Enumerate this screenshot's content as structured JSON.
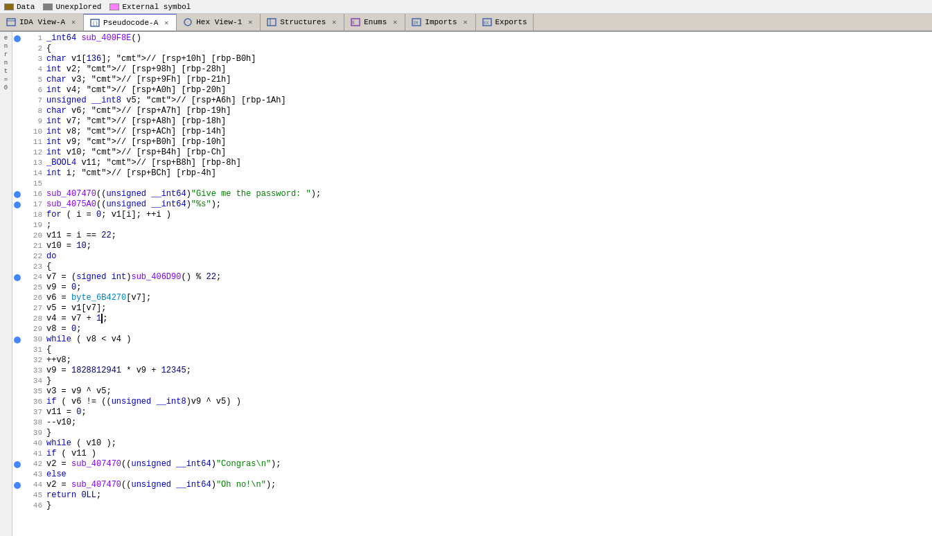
{
  "legend": {
    "items": [
      {
        "label": "Data",
        "color": "#8B6914"
      },
      {
        "label": "Unexplored",
        "color": "#808080"
      },
      {
        "label": "External symbol",
        "color": "#FF80FF"
      }
    ]
  },
  "tabs": [
    {
      "id": "ida-view-a",
      "label": "IDA View-A",
      "active": false,
      "closeable": true,
      "icon": "ida"
    },
    {
      "id": "pseudocode-a",
      "label": "Pseudocode-A",
      "active": true,
      "closeable": true,
      "icon": "pseudo"
    },
    {
      "id": "hex-view-1",
      "label": "Hex View-1",
      "active": false,
      "closeable": true,
      "icon": "hex"
    },
    {
      "id": "structures",
      "label": "Structures",
      "active": false,
      "closeable": true,
      "icon": "struct"
    },
    {
      "id": "enums",
      "label": "Enums",
      "active": false,
      "closeable": true,
      "icon": "enum"
    },
    {
      "id": "imports",
      "label": "Imports",
      "active": false,
      "closeable": true,
      "icon": "import"
    },
    {
      "id": "exports",
      "label": "Exports",
      "active": false,
      "closeable": false,
      "icon": "export"
    }
  ],
  "code": {
    "function_name": "sub_400F8E",
    "lines": [
      {
        "num": 1,
        "dot": true,
        "content": "_int64 sub_400F8E()"
      },
      {
        "num": 2,
        "dot": false,
        "content": "{"
      },
      {
        "num": 3,
        "dot": false,
        "content": "  char v1[136]; // [rsp+10h] [rbp-B0h]"
      },
      {
        "num": 4,
        "dot": false,
        "content": "  int v2; // [rsp+98h] [rbp-28h]"
      },
      {
        "num": 5,
        "dot": false,
        "content": "  char v3; // [rsp+9Fh] [rbp-21h]"
      },
      {
        "num": 6,
        "dot": false,
        "content": "  int v4; // [rsp+A0h] [rbp-20h]"
      },
      {
        "num": 7,
        "dot": false,
        "content": "  unsigned __int8 v5; // [rsp+A6h] [rbp-1Ah]"
      },
      {
        "num": 8,
        "dot": false,
        "content": "  char v6; // [rsp+A7h] [rbp-19h]"
      },
      {
        "num": 9,
        "dot": false,
        "content": "  int v7; // [rsp+A8h] [rbp-18h]"
      },
      {
        "num": 10,
        "dot": false,
        "content": "  int v8; // [rsp+ACh] [rbp-14h]"
      },
      {
        "num": 11,
        "dot": false,
        "content": "  int v9; // [rsp+B0h] [rbp-10h]"
      },
      {
        "num": 12,
        "dot": false,
        "content": "  int v10; // [rsp+B4h] [rbp-Ch]"
      },
      {
        "num": 13,
        "dot": false,
        "content": "  _BOOL4 v11; // [rsp+B8h] [rbp-8h]"
      },
      {
        "num": 14,
        "dot": false,
        "content": "  int i; // [rsp+BCh] [rbp-4h]"
      },
      {
        "num": 15,
        "dot": false,
        "content": ""
      },
      {
        "num": 16,
        "dot": true,
        "content": "  sub_407470((unsigned __int64)\"Give me the password: \");"
      },
      {
        "num": 17,
        "dot": true,
        "content": "  sub_4075A0((unsigned __int64)\"%s\");"
      },
      {
        "num": 18,
        "dot": false,
        "content": "  for ( i = 0; v1[i]; ++i )"
      },
      {
        "num": 19,
        "dot": false,
        "content": "    ;"
      },
      {
        "num": 20,
        "dot": false,
        "content": "  v11 = i == 22;"
      },
      {
        "num": 21,
        "dot": false,
        "content": "  v10 = 10;"
      },
      {
        "num": 22,
        "dot": false,
        "content": "  do"
      },
      {
        "num": 23,
        "dot": false,
        "content": "  {"
      },
      {
        "num": 24,
        "dot": true,
        "content": "    v7 = (signed int)sub_406D90() % 22;"
      },
      {
        "num": 25,
        "dot": false,
        "content": "    v9 = 0;"
      },
      {
        "num": 26,
        "dot": false,
        "content": "    v6 = byte_6B4270[v7];"
      },
      {
        "num": 27,
        "dot": false,
        "content": "    v5 = v1[v7];"
      },
      {
        "num": 28,
        "dot": false,
        "content": "    v4 = v7 + 1;"
      },
      {
        "num": 29,
        "dot": false,
        "content": "    v8 = 0;"
      },
      {
        "num": 30,
        "dot": true,
        "content": "    while ( v8 < v4 )"
      },
      {
        "num": 31,
        "dot": false,
        "content": "    {"
      },
      {
        "num": 32,
        "dot": false,
        "content": "      ++v8;"
      },
      {
        "num": 33,
        "dot": false,
        "content": "      v9 = 1828812941 * v9 + 12345;"
      },
      {
        "num": 34,
        "dot": false,
        "content": "    }"
      },
      {
        "num": 35,
        "dot": false,
        "content": "    v3 = v9 ^ v5;"
      },
      {
        "num": 36,
        "dot": false,
        "content": "    if ( v6 != ((unsigned __int8)v9 ^ v5) )"
      },
      {
        "num": 37,
        "dot": false,
        "content": "      v11 = 0;"
      },
      {
        "num": 38,
        "dot": false,
        "content": "    --v10;"
      },
      {
        "num": 39,
        "dot": false,
        "content": "  }"
      },
      {
        "num": 40,
        "dot": false,
        "content": "  while ( v10 );"
      },
      {
        "num": 41,
        "dot": false,
        "content": "  if ( v11 )"
      },
      {
        "num": 42,
        "dot": true,
        "content": "    v2 = sub_407470((unsigned __int64)\"Congras\\n\");"
      },
      {
        "num": 43,
        "dot": false,
        "content": "  else"
      },
      {
        "num": 44,
        "dot": true,
        "content": "    v2 = sub_407470((unsigned __int64)\"Oh no!\\n\");"
      },
      {
        "num": 45,
        "dot": false,
        "content": "  return 0LL;"
      },
      {
        "num": 46,
        "dot": false,
        "content": "}"
      }
    ]
  }
}
